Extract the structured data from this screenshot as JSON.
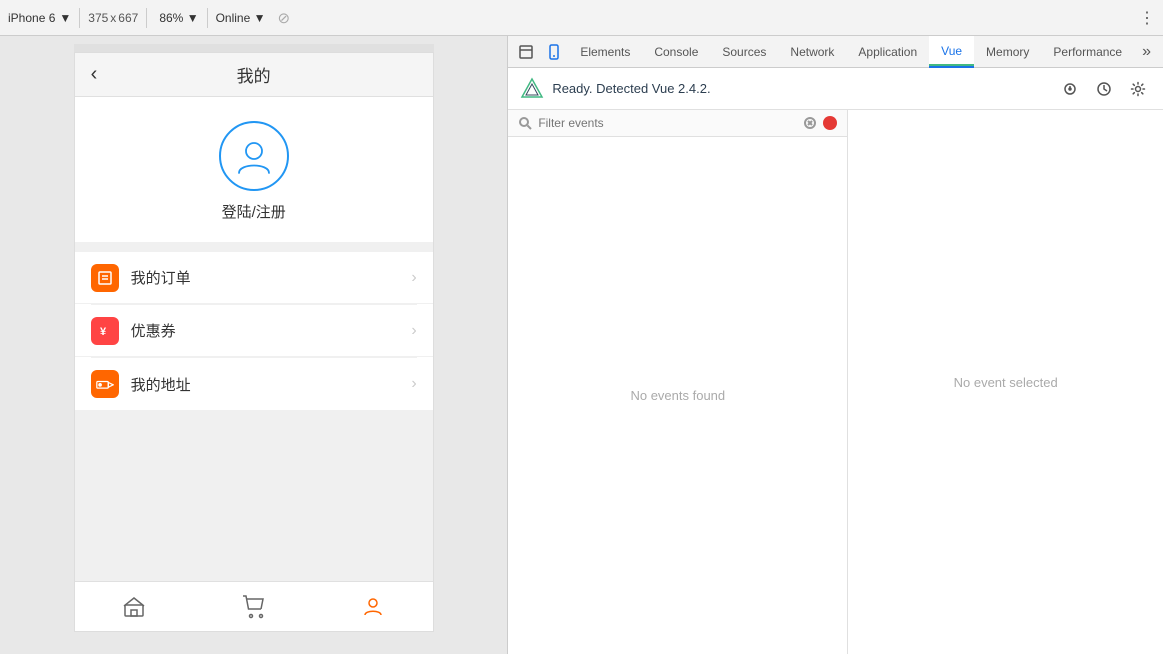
{
  "topbar": {
    "device": "iPhone 6",
    "device_arrow": "▼",
    "width": "375",
    "x_label": "x",
    "height": "667",
    "zoom": "86%",
    "zoom_arrow": "▼",
    "network": "Online",
    "network_arrow": "▼",
    "more_icon": "⋮"
  },
  "devtools": {
    "tabs": [
      {
        "label": "Elements",
        "active": false
      },
      {
        "label": "Console",
        "active": false
      },
      {
        "label": "Sources",
        "active": false
      },
      {
        "label": "Network",
        "active": false
      },
      {
        "label": "Application",
        "active": false
      },
      {
        "label": "Vue",
        "active": true
      },
      {
        "label": "Memory",
        "active": false
      },
      {
        "label": "Performance",
        "active": false
      }
    ],
    "overflow_btn": "»",
    "actions": {
      "inspect_icon": "⬚",
      "device_icon": "📱",
      "person_icon": "👤",
      "history_icon": "⟳",
      "settings_icon": "⚙"
    }
  },
  "vue": {
    "detected_text": "Ready. Detected Vue 2.4.2.",
    "filter_placeholder": "Filter events",
    "no_events_text": "No events found",
    "no_event_selected_text": "No event selected",
    "record_btn_label": "Record"
  },
  "app": {
    "title": "我的",
    "login_text": "登陆/注册",
    "menu_items": [
      {
        "label": "我的订单",
        "icon": "≡",
        "icon_color": "orange"
      },
      {
        "label": "优惠券",
        "icon": "¥",
        "icon_color": "red"
      },
      {
        "label": "我的地址",
        "icon": "🚚",
        "icon_color": "orange2"
      }
    ],
    "tabs": [
      {
        "label": "home",
        "active": false
      },
      {
        "label": "cart",
        "active": false
      },
      {
        "label": "profile",
        "active": true
      }
    ]
  }
}
